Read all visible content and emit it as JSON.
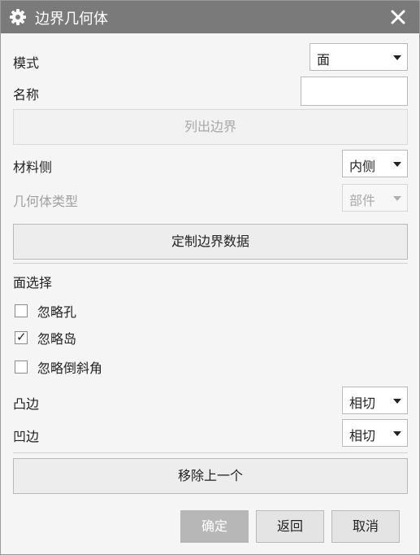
{
  "dialog": {
    "title": "边界几何体",
    "icons": {
      "title": "gear-icon",
      "close": "close-icon"
    }
  },
  "mode": {
    "label": "模式",
    "value": "面"
  },
  "name": {
    "label": "名称",
    "value": ""
  },
  "list_boundary_button": "列出边界",
  "material_side": {
    "label": "材料侧",
    "value": "内侧"
  },
  "geometry_type": {
    "label": "几何体类型",
    "value": "部件"
  },
  "custom_boundary_button": "定制边界数据",
  "face_selection": {
    "heading": "面选择",
    "options": [
      {
        "label": "忽略孔",
        "checked": false
      },
      {
        "label": "忽略岛",
        "checked": true,
        "mark": "✓"
      },
      {
        "label": "忽略倒斜角",
        "checked": false
      }
    ]
  },
  "convex_edge": {
    "label": "凸边",
    "value": "相切"
  },
  "concave_edge": {
    "label": "凹边",
    "value": "相切"
  },
  "remove_previous_button": "移除上一个",
  "footer": {
    "ok": "确定",
    "back": "返回",
    "cancel": "取消"
  }
}
